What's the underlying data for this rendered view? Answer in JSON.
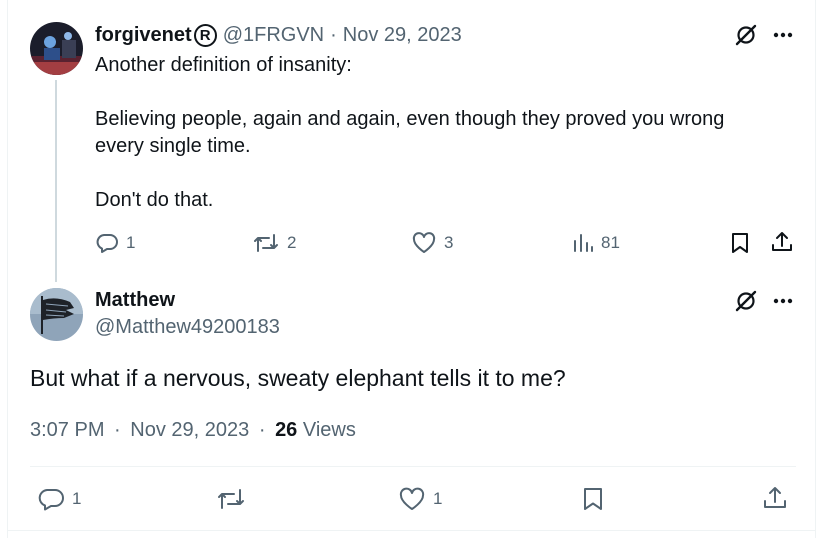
{
  "tweet1": {
    "display_name": "forgivenet",
    "badge_symbol": "R",
    "handle": "@1FRGVN",
    "separator": "·",
    "date": "Nov 29, 2023",
    "lines": [
      "Another definition of insanity:",
      "",
      "Believing people, again and again, even though they proved you wrong",
      "every single time.",
      "",
      "Don't do that."
    ],
    "actions": {
      "replies": "1",
      "reposts": "2",
      "likes": "3",
      "views": "81"
    },
    "icons": {
      "grok": "grok-slash-circle-icon",
      "more": "more-dots-icon",
      "reply": "reply-bubble-icon",
      "repost": "repost-arrows-icon",
      "like": "heart-icon",
      "views": "bar-chart-icon",
      "bookmark": "bookmark-icon",
      "share": "share-upload-icon"
    }
  },
  "tweet2": {
    "display_name": "Matthew",
    "handle": "@Matthew49200183",
    "text": "But what if a nervous, sweaty elephant tells it to me?",
    "time": "3:07 PM",
    "separator": "·",
    "date": "Nov 29, 2023",
    "views_count": "26",
    "views_label": "Views",
    "actions": {
      "replies": "1",
      "reposts": "",
      "likes": "1"
    }
  },
  "colors": {
    "text": "#0f1419",
    "muted": "#536471",
    "border": "#eff3f4",
    "thread": "#cfd9de"
  }
}
